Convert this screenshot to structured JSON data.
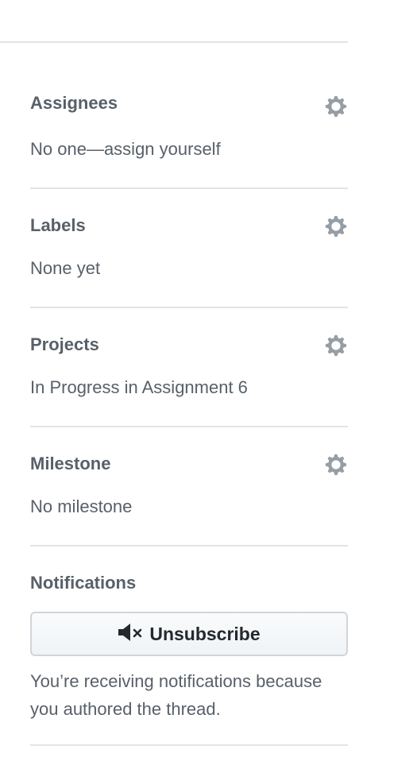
{
  "sidebar": {
    "assignees": {
      "title": "Assignees",
      "value": "No one—assign yourself",
      "settings_icon": "gear-icon"
    },
    "labels": {
      "title": "Labels",
      "value": "None yet",
      "settings_icon": "gear-icon"
    },
    "projects": {
      "title": "Projects",
      "value": "In Progress in Assignment 6",
      "settings_icon": "gear-icon"
    },
    "milestone": {
      "title": "Milestone",
      "value": "No milestone",
      "settings_icon": "gear-icon"
    },
    "notifications": {
      "title": "Notifications",
      "button_label": "Unsubscribe",
      "button_icon": "mute-icon",
      "reason": "You’re receiving notifications because you authored the thread."
    }
  },
  "colors": {
    "heading": "#586069",
    "text": "#586069",
    "divider": "#e1e4e8",
    "gear": "#959da5",
    "button_text": "#24292e"
  }
}
